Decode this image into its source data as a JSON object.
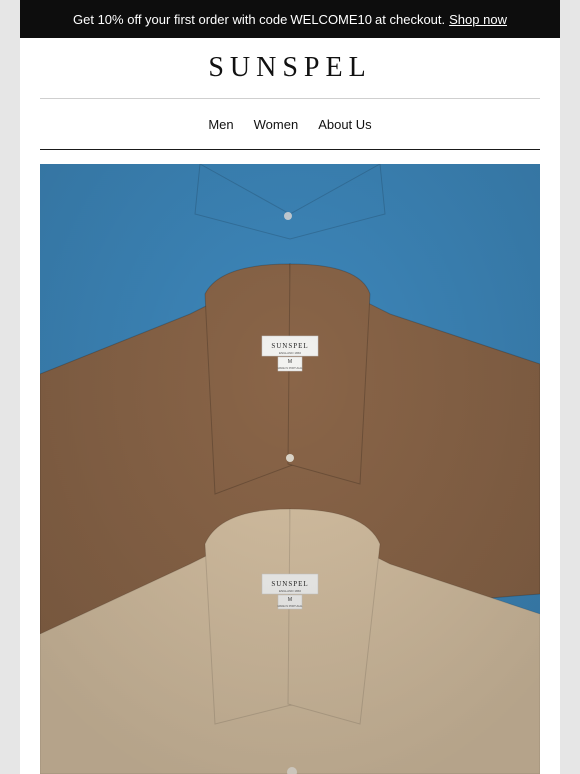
{
  "banner": {
    "text": "Get 10% off your first order with code",
    "code": "WELCOME10",
    "suffix": "at checkout.",
    "link": "Shop now"
  },
  "logo": "SUNSPEL",
  "nav": [
    "Men",
    "Women",
    "About Us"
  ],
  "hero": {
    "label_brand": "SUNSPEL",
    "label_origin": "ENGLAND 1860",
    "label_size": "M",
    "label_made": "MADE IN PORTUGAL",
    "colors": {
      "blue": "#3b87bd",
      "brown": "#8a6446",
      "beige": "#d8c2a3"
    }
  }
}
